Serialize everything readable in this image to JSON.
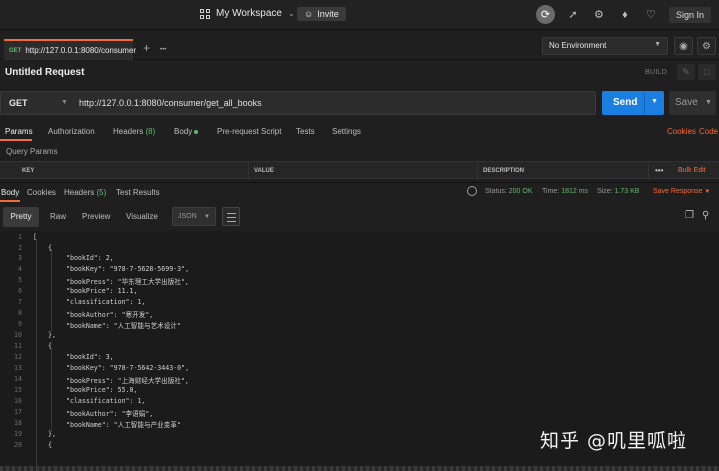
{
  "topbar": {
    "workspace_label": "My Workspace",
    "invite_label": "Invite",
    "signin_label": "Sign In",
    "icons": [
      "sync-icon",
      "satellite-icon",
      "settings-icon",
      "bell-icon",
      "heart-icon"
    ]
  },
  "tabs": {
    "request_tab": {
      "method": "GET",
      "label": "http://127.0.0.1:8080/consumer"
    },
    "add_symbol": "+",
    "more_symbol": "•••"
  },
  "environment": {
    "selected": "No Environment"
  },
  "request": {
    "title": "Untitled Request",
    "build_label": "BUILD",
    "method": "GET",
    "url": "http://127.0.0.1:8080/consumer/get_all_books",
    "send_label": "Send",
    "save_label": "Save"
  },
  "request_tabs": {
    "params": "Params",
    "authorization": "Authorization",
    "headers": "Headers",
    "headers_count": "(8)",
    "body": "Body",
    "prerequest": "Pre-request Script",
    "tests": "Tests",
    "settings": "Settings",
    "cookies": "Cookies",
    "code": "Code"
  },
  "query_params": {
    "title": "Query Params",
    "col_key": "KEY",
    "col_value": "VALUE",
    "col_description": "DESCRIPTION",
    "bulk_edit": "Bulk Edit",
    "more_symbol": "•••"
  },
  "response": {
    "tab_body": "Body",
    "tab_cookies": "Cookies",
    "tab_headers": "Headers",
    "headers_count": "(5)",
    "tab_tests": "Test Results",
    "status_label": "Status:",
    "status_value": "200 OK",
    "time_label": "Time:",
    "time_value": "1812 ms",
    "size_label": "Size:",
    "size_value": "1.73 KB",
    "save_response": "Save Response"
  },
  "format_bar": {
    "pretty": "Pretty",
    "raw": "Raw",
    "preview": "Preview",
    "visualize": "Visualize",
    "format": "JSON"
  },
  "code_lines": [
    "[",
    "{",
    "\"bookId\": 2,",
    "\"bookKey\": \"978-7-5628-5699-3\",",
    "\"bookPress\": \"华东理工大学出版社\",",
    "\"bookPrice\": 11.1,",
    "\"classification\": 1,",
    "\"bookAuthor\": \"寒开发\",",
    "\"bookName\": \"人工智能与艺术设计\"",
    "},",
    "{",
    "\"bookId\": 3,",
    "\"bookKey\": \"978-7-5642-3443-0\",",
    "\"bookPress\": \"上海财经大学出版社\",",
    "\"bookPrice\": 55.0,",
    "\"classification\": 1,",
    "\"bookAuthor\": \"李语娟\",",
    "\"bookName\": \"人工智能与产业变革\"",
    "},",
    "{"
  ],
  "line_numbers": [
    "1",
    "2",
    "3",
    "4",
    "5",
    "6",
    "7",
    "8",
    "9",
    "10",
    "11",
    "12",
    "13",
    "14",
    "15",
    "16",
    "17",
    "18",
    "19",
    "20"
  ],
  "watermark": "知乎 @叽里呱啦",
  "colors": {
    "accent": "#f26b3a",
    "send": "#1a7fe0",
    "success": "#5ebd6b"
  }
}
